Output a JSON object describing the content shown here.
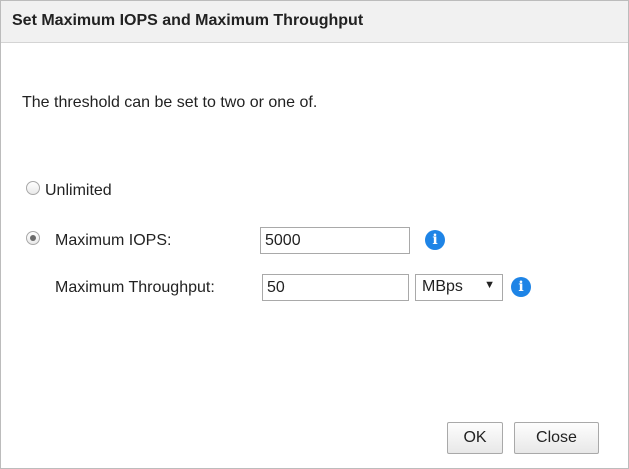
{
  "dialog": {
    "title": "Set Maximum IOPS and Maximum Throughput",
    "description": "The threshold can be set to two or one of."
  },
  "options": {
    "unlimited": {
      "label": "Unlimited",
      "selected": false
    },
    "maximum_iops": {
      "label": "Maximum IOPS:",
      "selected": true,
      "value": "5000"
    },
    "maximum_throughput": {
      "label": "Maximum Throughput:",
      "value": "50",
      "unit": "MBps",
      "unit_arrow": "▼"
    }
  },
  "icons": {
    "info": "info-icon",
    "info_glyph": "i"
  },
  "buttons": {
    "ok": "OK",
    "close": "Close"
  },
  "colors": {
    "accent": "#1e84e6",
    "title_bar": "#f1f1f1"
  }
}
